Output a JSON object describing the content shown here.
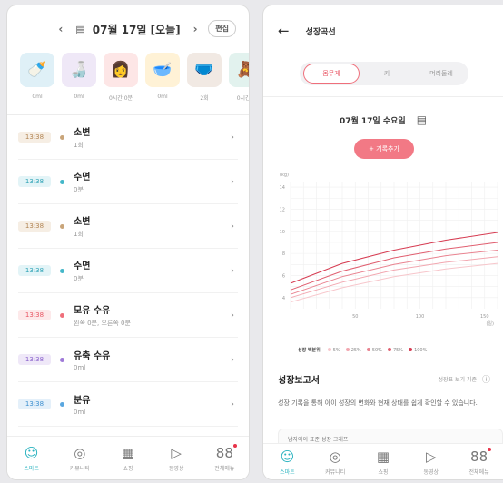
{
  "left": {
    "date_label": "07월 17일 [오늘]",
    "prev_arrow": "‹",
    "next_arrow": "›",
    "edit_label": "편집",
    "categories": [
      {
        "icon": "🍼",
        "value": "0ml",
        "bg": "#dff0f7"
      },
      {
        "icon": "🍶",
        "value": "0ml",
        "bg": "#efe8f7"
      },
      {
        "icon": "👩",
        "value": "0시간 0분",
        "bg": "#fde6e6"
      },
      {
        "icon": "🥣",
        "value": "0ml",
        "bg": "#fff2d6"
      },
      {
        "icon": "🩲",
        "value": "2회",
        "bg": "#f1e9e3"
      },
      {
        "icon": "🧸",
        "value": "0시간 0",
        "bg": "#e2f2ee"
      }
    ],
    "records": [
      {
        "time": "13:38",
        "title": "소변",
        "sub": "1회",
        "color": "#c9a57a",
        "bg": "#f6eee4",
        "fg": "#b28554"
      },
      {
        "time": "13:38",
        "title": "수면",
        "sub": "0분",
        "color": "#44b7c9",
        "bg": "#e3f4f7",
        "fg": "#2fa3b6"
      },
      {
        "time": "13:38",
        "title": "소변",
        "sub": "1회",
        "color": "#c9a57a",
        "bg": "#f6eee4",
        "fg": "#b28554"
      },
      {
        "time": "13:38",
        "title": "수면",
        "sub": "0분",
        "color": "#44b7c9",
        "bg": "#e3f4f7",
        "fg": "#2fa3b6"
      },
      {
        "time": "13:38",
        "title": "모유 수유",
        "sub": "왼쪽 0분, 오른쪽 0분",
        "color": "#ef6f7b",
        "bg": "#fde9ea",
        "fg": "#e85563"
      },
      {
        "time": "13:38",
        "title": "유축 수유",
        "sub": "0ml",
        "color": "#9f7ad8",
        "bg": "#efe8f8",
        "fg": "#8a62cc"
      },
      {
        "time": "13:38",
        "title": "분유",
        "sub": "0ml",
        "color": "#5aa7e0",
        "bg": "#e4f0fa",
        "fg": "#3d8fcf"
      }
    ],
    "chevron": "›"
  },
  "tabs": [
    {
      "label": "스마트",
      "icon": "☺",
      "active": true
    },
    {
      "label": "커뮤니티",
      "icon": "◎",
      "active": false
    },
    {
      "label": "쇼핑",
      "icon": "▦",
      "active": false
    },
    {
      "label": "동영상",
      "icon": "▷",
      "active": false
    },
    {
      "label": "전체메뉴",
      "icon": "88",
      "active": false,
      "dot": true
    }
  ],
  "right": {
    "back": "←",
    "title": "성장곡선",
    "segments": [
      "몸무게",
      "키",
      "머리둘레"
    ],
    "date": "07월 17일 수요일",
    "add_button": "+ 기록추가",
    "legend_title": "성장 백분위",
    "legend": [
      {
        "label": "5%",
        "color": "#f7c6cb"
      },
      {
        "label": "25%",
        "color": "#f2a7b0"
      },
      {
        "label": "50%",
        "color": "#e98390"
      },
      {
        "label": "75%",
        "color": "#e05e6f"
      },
      {
        "label": "100%",
        "color": "#d63b51"
      }
    ],
    "report_title": "성장보고서",
    "report_sub": "성장표 보기 기준",
    "report_info": "ⓘ",
    "report_desc": "성장 기록을 통해 아이 성장의 변화와 현재 상태를 쉽게 확인할 수 있습니다.",
    "peek_text": "남자아이 표준 성장 그래프"
  },
  "chart_data": {
    "type": "line",
    "ylabel": "(kg)",
    "xlabel": "(일)",
    "yticks": [
      4,
      6,
      8,
      10,
      12,
      14
    ],
    "xticks": [
      50,
      100,
      150
    ],
    "xlim": [
      0,
      160
    ],
    "ylim": [
      3,
      14.5
    ],
    "grid": true,
    "series": [
      {
        "name": "5%",
        "x": [
          0,
          40,
          80,
          120,
          160
        ],
        "y": [
          3.6,
          4.9,
          5.9,
          6.6,
          7.1
        ]
      },
      {
        "name": "25%",
        "x": [
          0,
          40,
          80,
          120,
          160
        ],
        "y": [
          4.0,
          5.4,
          6.5,
          7.2,
          7.7
        ]
      },
      {
        "name": "50%",
        "x": [
          0,
          40,
          80,
          120,
          160
        ],
        "y": [
          4.3,
          5.9,
          7.0,
          7.8,
          8.3
        ]
      },
      {
        "name": "75%",
        "x": [
          0,
          40,
          80,
          120,
          160
        ],
        "y": [
          4.7,
          6.4,
          7.6,
          8.4,
          9.0
        ]
      },
      {
        "name": "100%",
        "x": [
          0,
          40,
          80,
          120,
          160
        ],
        "y": [
          5.3,
          7.1,
          8.3,
          9.2,
          9.9
        ]
      }
    ]
  }
}
